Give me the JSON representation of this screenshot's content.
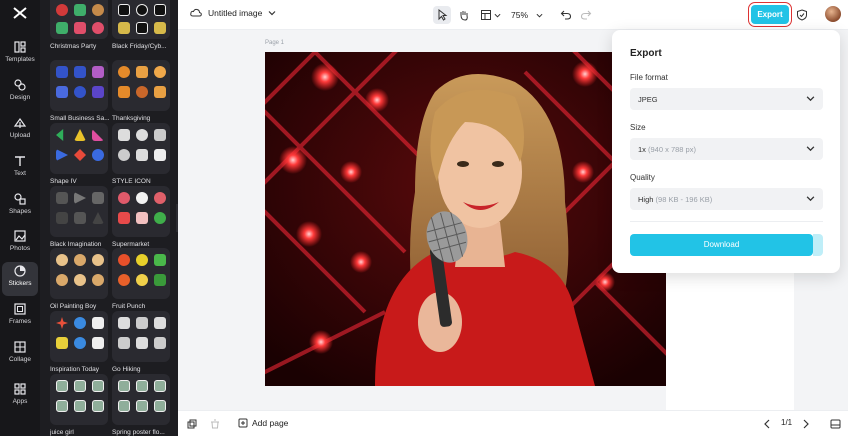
{
  "rail": {
    "items": [
      {
        "label": "Templates",
        "icon": "templates-icon"
      },
      {
        "label": "Design",
        "icon": "design-icon"
      },
      {
        "label": "Upload",
        "icon": "upload-icon"
      },
      {
        "label": "Text",
        "icon": "text-icon"
      },
      {
        "label": "Shapes",
        "icon": "shapes-icon"
      },
      {
        "label": "Photos",
        "icon": "photos-icon"
      },
      {
        "label": "Stickers",
        "icon": "stickers-icon"
      },
      {
        "label": "Frames",
        "icon": "frames-icon"
      },
      {
        "label": "Collage",
        "icon": "collage-icon"
      },
      {
        "label": "Apps",
        "icon": "apps-icon"
      }
    ]
  },
  "stickers": [
    {
      "label": "Christmas Party"
    },
    {
      "label": "Black Friday/Cyb..."
    },
    {
      "label": "Small Business Sa..."
    },
    {
      "label": "Thanksgiving"
    },
    {
      "label": "Shape IV"
    },
    {
      "label": "STYLE ICON"
    },
    {
      "label": "Black Imagination"
    },
    {
      "label": "Supermarket"
    },
    {
      "label": "Oil Painting Boy"
    },
    {
      "label": "Fruit Punch"
    },
    {
      "label": "Inspiration Today"
    },
    {
      "label": "Go Hiking"
    },
    {
      "label": "juice girl"
    },
    {
      "label": "Spring poster flo..."
    }
  ],
  "topbar": {
    "title": "Untitled image",
    "zoom": "75%",
    "export_label": "Export"
  },
  "canvas": {
    "page_label": "Page 1"
  },
  "bottombar": {
    "add_page": "Add page",
    "pager": "1/1"
  },
  "export_dialog": {
    "title": "Export",
    "file_format_label": "File format",
    "file_format_value": "JPEG",
    "size_label": "Size",
    "size_value": "1x",
    "size_detail": "(940 x 788 px)",
    "quality_label": "Quality",
    "quality_value": "High",
    "quality_detail": "(98 KB - 196 KB)",
    "download_label": "Download"
  },
  "colors": {
    "accent": "#22c3e6",
    "rail_bg": "#17171a",
    "panel_bg": "#1d1d21"
  }
}
